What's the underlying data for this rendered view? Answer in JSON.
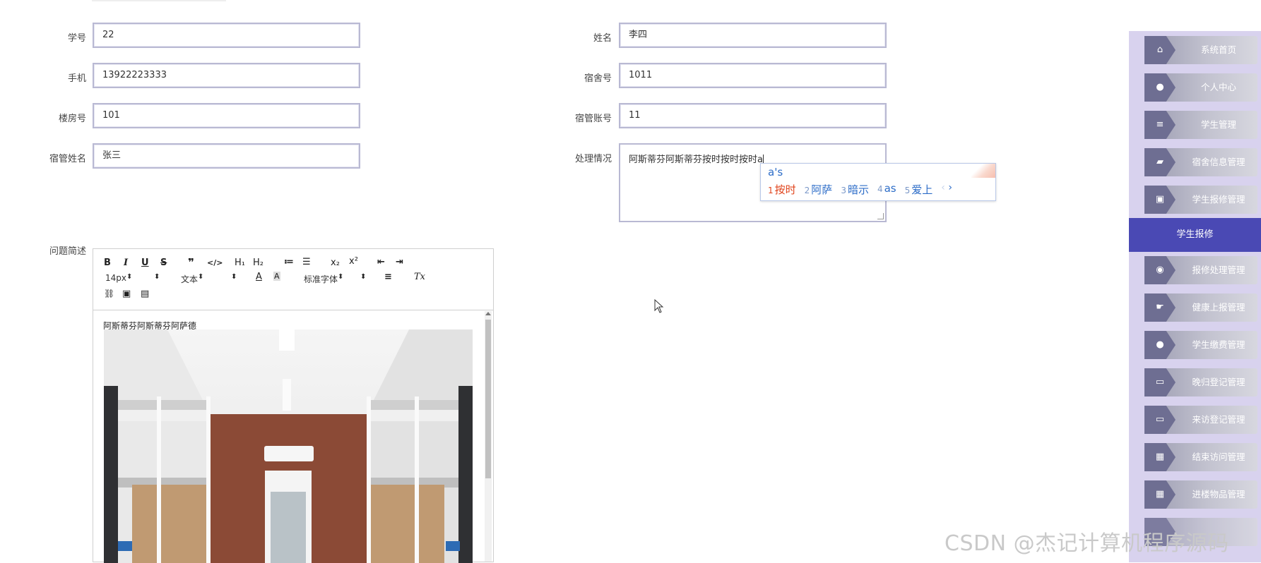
{
  "form": {
    "student_id": {
      "label": "学号",
      "value": "22"
    },
    "name": {
      "label": "姓名",
      "value": "李四"
    },
    "phone": {
      "label": "手机",
      "value": "13922223333"
    },
    "dorm_no": {
      "label": "宿舍号",
      "value": "1011"
    },
    "building_no": {
      "label": "楼房号",
      "value": "101"
    },
    "manager_account": {
      "label": "宿管账号",
      "value": "11"
    },
    "manager_name": {
      "label": "宿管姓名",
      "value": "张三"
    },
    "handling": {
      "label": "处理情况",
      "value": "阿斯蒂芬阿斯蒂芬按时按时按时a"
    },
    "issue": {
      "label": "问题简述"
    }
  },
  "ime": {
    "composition": "a's",
    "candidates": [
      {
        "num": "1",
        "text": "按时"
      },
      {
        "num": "2",
        "text": "阿萨"
      },
      {
        "num": "3",
        "text": "暗示"
      },
      {
        "num": "4",
        "text": "as"
      },
      {
        "num": "5",
        "text": "爱上"
      }
    ],
    "prev": "‹",
    "next": "›"
  },
  "editor": {
    "toolbar": {
      "bold": "B",
      "italic": "I",
      "underline": "U",
      "strike": "S",
      "quote": "❞",
      "code": "</>",
      "h1": "H₁",
      "h2": "H₂",
      "ol": "≔",
      "ul": "☰",
      "sub": "x₂",
      "sup": "x²",
      "outdent": "⇤",
      "indent": "⇥",
      "size": "14px",
      "format": "文本",
      "font": "标准字体",
      "align": "≡",
      "clean": "Tx",
      "link": "🔗",
      "image": "▣",
      "video": "▤"
    },
    "content_text": "阿斯蒂芬阿斯蒂芬阿萨德"
  },
  "sidebar": {
    "items": [
      {
        "label": "系统首页",
        "icon": "home-icon",
        "glyph": "⌂"
      },
      {
        "label": "个人中心",
        "icon": "user-icon",
        "glyph": "●"
      },
      {
        "label": "学生管理",
        "icon": "list-icon",
        "glyph": "≡"
      },
      {
        "label": "宿舍信息管理",
        "icon": "ticket-icon",
        "glyph": "▰"
      },
      {
        "label": "学生报修管理",
        "icon": "briefcase-icon",
        "glyph": "▣"
      },
      {
        "label": "报修处理管理",
        "icon": "bulb-icon",
        "glyph": "◉"
      },
      {
        "label": "健康上报管理",
        "icon": "hand-icon",
        "glyph": "☛"
      },
      {
        "label": "学生缴费管理",
        "icon": "user-icon",
        "glyph": "●"
      },
      {
        "label": "晚归登记管理",
        "icon": "monitor-icon",
        "glyph": "▭"
      },
      {
        "label": "来访登记管理",
        "icon": "monitor-icon",
        "glyph": "▭"
      },
      {
        "label": "结束访问管理",
        "icon": "grid-icon",
        "glyph": "▦"
      },
      {
        "label": "进楼物品管理",
        "icon": "grid-icon",
        "glyph": "▦"
      }
    ],
    "active": "学生报修"
  },
  "watermark": "CSDN @杰记计算机程序源码",
  "colors": {
    "sidebar_bg": "#d8d2ee",
    "active": "#4a49b4",
    "input_border": "#b9b9d3"
  }
}
